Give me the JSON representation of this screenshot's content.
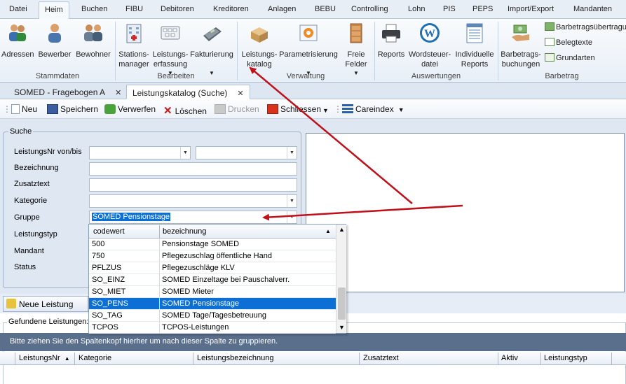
{
  "menu": {
    "tabs": [
      "Datei",
      "Heim",
      "Buchen",
      "FIBU",
      "Debitoren",
      "Kreditoren",
      "Anlagen",
      "BEBU",
      "Controlling",
      "Lohn",
      "PIS",
      "PEPS",
      "Import/Export",
      "Mandanten"
    ],
    "active": "Heim"
  },
  "ribbon": {
    "stammdaten": {
      "group": "Stammdaten",
      "adressen": "Adressen",
      "bewerber": "Bewerber",
      "bewohner": "Bewohner"
    },
    "bearbeiten": {
      "group": "Bearbeiten",
      "stations_1": "Stations-",
      "stations_2": "manager",
      "leistungserfassung_1": "Leistungs-",
      "leistungserfassung_2": "erfassung",
      "fakturierung": "Fakturierung"
    },
    "verwaltung": {
      "group": "Verwaltung",
      "leistungskatalog_1": "Leistungs-",
      "leistungskatalog_2": "katalog",
      "parametrisierung": "Parametrisierung",
      "freie_1": "Freie",
      "freie_2": "Felder"
    },
    "auswertungen": {
      "group": "Auswertungen",
      "reports": "Reports",
      "wordsteuer_1": "Wordsteuer-",
      "wordsteuer_2": "datei",
      "individuelle_1": "Individuelle",
      "individuelle_2": "Reports"
    },
    "barbetrag": {
      "group": "Barbetrag",
      "buchungen_1": "Barbetrags-",
      "buchungen_2": "buchungen",
      "uebertragung": "Barbetragsübertragu",
      "belegtexte": "Belegtexte",
      "grundarten": "Grundarten"
    }
  },
  "doctabs": [
    {
      "label": "SOMED - Fragebogen A",
      "close": "✕"
    },
    {
      "label": "Leistungskatalog (Suche)",
      "close": "✕"
    }
  ],
  "toolbar": {
    "neu": "Neu",
    "speichern": "Speichern",
    "verwerfen": "Verwerfen",
    "loeschen": "Löschen",
    "drucken": "Drucken",
    "schliessen": "Schliessen",
    "careindex": "Careindex"
  },
  "suche": {
    "title": "Suche",
    "labels": {
      "leistungsnr": "LeistungsNr von/bis",
      "bezeichnung": "Bezeichnung",
      "zusatztext": "Zusatztext",
      "kategorie": "Kategorie",
      "gruppe": "Gruppe",
      "leistungstyp": "Leistungstyp",
      "mandant": "Mandant",
      "status": "Status"
    },
    "gruppe_value": "SOMED Pensionstage"
  },
  "dropdown": {
    "headers": {
      "codewert": "codewert",
      "bezeichnung": "bezeichnung"
    },
    "rows": [
      {
        "code": "500",
        "bez": "Pensionstage SOMED"
      },
      {
        "code": "750",
        "bez": "Pflegezuschlag öffentliche Hand"
      },
      {
        "code": "PFLZUS",
        "bez": "Pflegezuschläge KLV"
      },
      {
        "code": "SO_EINZ",
        "bez": "SOMED Einzeltage bei Pauschalverr."
      },
      {
        "code": "SO_MIET",
        "bez": "SOMED Mieter"
      },
      {
        "code": "SO_PENS",
        "bez": "SOMED Pensionstage"
      },
      {
        "code": "SO_TAG",
        "bez": "SOMED Tage/Tagesbetreuung"
      },
      {
        "code": "TCPOS",
        "bez": "TCPOS-Leistungen"
      }
    ],
    "selected_code": "SO_PENS"
  },
  "neue_leistung": "Neue Leistung",
  "gefunden": "Gefundene Leistungen:",
  "group_hint": "Bitte ziehen Sie den Spaltenkopf hierher um nach dieser Spalte zu gruppieren.",
  "grid_columns": [
    "LeistungsNr",
    "Kategorie",
    "Leistungsbezeichnung",
    "Zusatztext",
    "Aktiv",
    "Leistungstyp"
  ],
  "colors": {
    "selection": "#0b6fd6",
    "arrow": "#c0101a",
    "groupbar": "#5a6f8c"
  }
}
